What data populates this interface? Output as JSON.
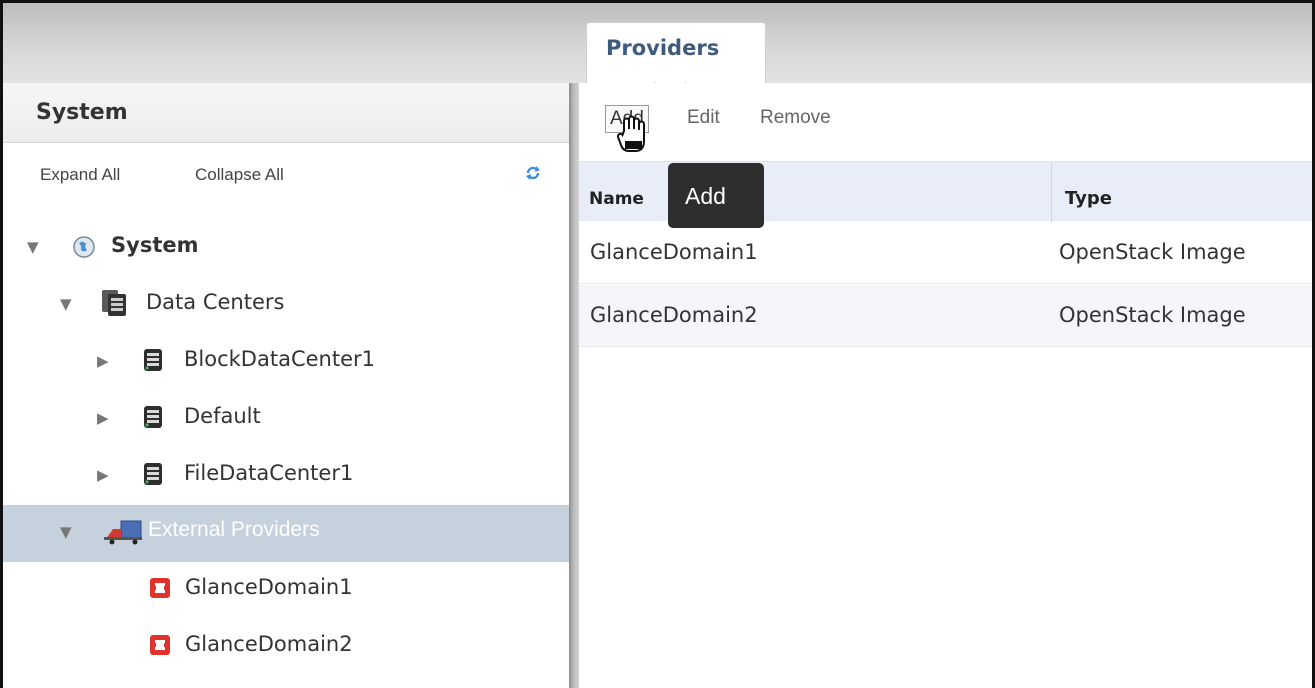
{
  "tab": {
    "label": "Providers"
  },
  "left_panel": {
    "title": "System",
    "expand_all": "Expand All",
    "collapse_all": "Collapse All",
    "tree": [
      {
        "label": "System",
        "icon": "globe-icon",
        "expanded": true
      },
      {
        "label": "Data Centers",
        "icon": "datacenters-icon",
        "expanded": true
      },
      {
        "label": "BlockDataCenter1",
        "icon": "datacenter-icon",
        "expanded": false
      },
      {
        "label": "Default",
        "icon": "datacenter-icon",
        "expanded": false
      },
      {
        "label": "FileDataCenter1",
        "icon": "datacenter-icon",
        "expanded": false
      },
      {
        "label": "External Providers",
        "icon": "truck-icon",
        "expanded": true,
        "selected": true
      },
      {
        "label": "GlanceDomain1",
        "icon": "openstack-icon"
      },
      {
        "label": "GlanceDomain2",
        "icon": "openstack-icon"
      }
    ]
  },
  "toolbar": {
    "add": "Add",
    "edit": "Edit",
    "remove": "Remove"
  },
  "grid": {
    "columns": [
      "Name",
      "Type"
    ],
    "rows": [
      {
        "name": "GlanceDomain1",
        "type": "OpenStack Image"
      },
      {
        "name": "GlanceDomain2",
        "type": "OpenStack Image"
      }
    ]
  },
  "tooltip": "Add",
  "colors": {
    "selected_row": "#c6d1de",
    "tab_text": "#3e5b7f",
    "openstack_red": "#e0332c"
  }
}
